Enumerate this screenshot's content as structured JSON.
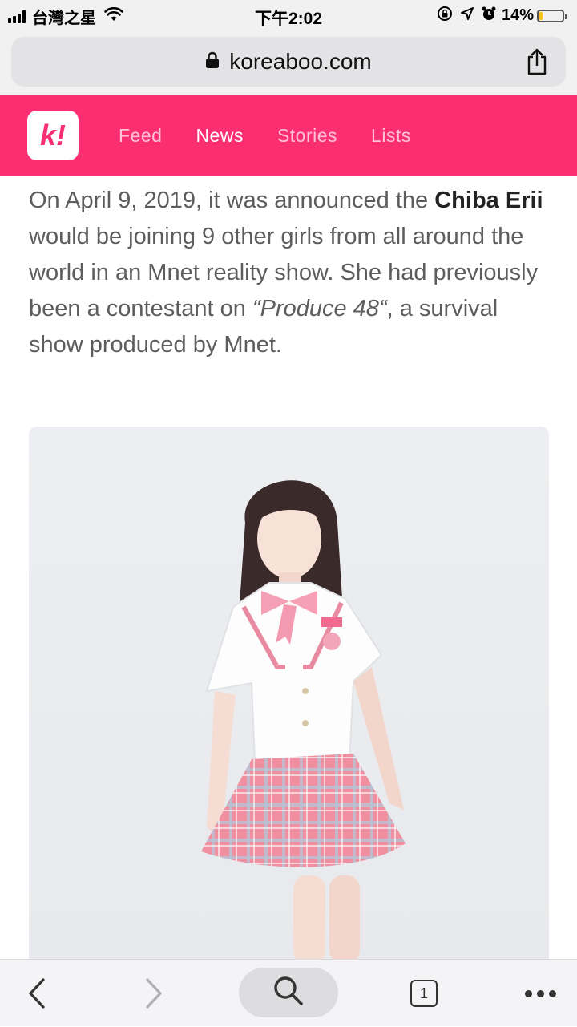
{
  "status_bar": {
    "carrier": "台灣之星",
    "time": "下午2:02",
    "battery_percent": "14%",
    "battery_level": 0.14,
    "icons": [
      "signal-icon",
      "wifi-icon",
      "orientation-lock-icon",
      "location-icon",
      "alarm-icon",
      "battery-icon"
    ]
  },
  "browser": {
    "url": "koreaboo.com",
    "tab_count": "1",
    "icons": [
      "lock-icon",
      "share-icon",
      "back-icon",
      "forward-icon",
      "search-icon",
      "tabs-icon",
      "more-icon"
    ]
  },
  "site": {
    "logo_text": "k!",
    "brand_color": "#fb2e72",
    "nav": {
      "feed": "Feed",
      "news": "News",
      "stories": "Stories",
      "lists": "Lists"
    },
    "active_nav": "News"
  },
  "article": {
    "p1_a": "On April 9, 2019, it was announced the ",
    "p1_name": "Chiba Erii",
    "p1_b": " would be joining 9 other girls from all around the world in an Mnet reality show. She had previously been a contestant on ",
    "p1_show": "“Produce 48“",
    "p1_c": ", a survival show produced by Mnet."
  }
}
